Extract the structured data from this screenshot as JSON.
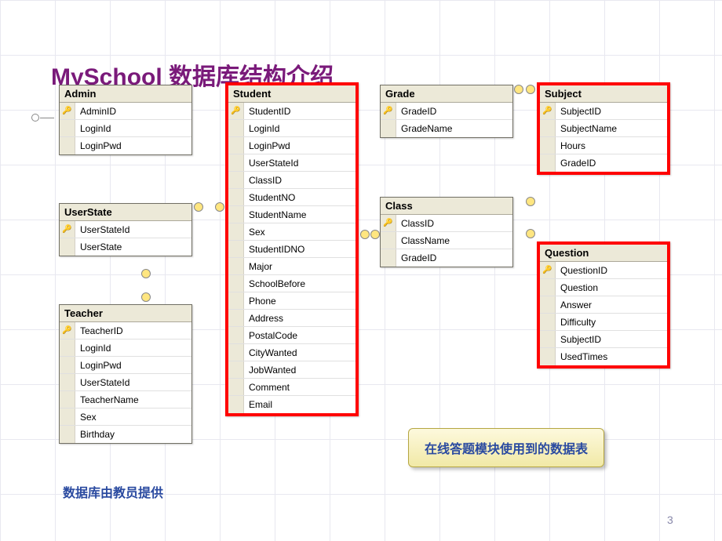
{
  "title": "MySchool 数据库结构介绍",
  "tables": {
    "admin": {
      "name": "Admin",
      "cols": [
        {
          "k": true,
          "n": "AdminID"
        },
        {
          "k": false,
          "n": "LoginId"
        },
        {
          "k": false,
          "n": "LoginPwd"
        }
      ]
    },
    "userstate": {
      "name": "UserState",
      "cols": [
        {
          "k": true,
          "n": "UserStateId"
        },
        {
          "k": false,
          "n": "UserState"
        }
      ]
    },
    "teacher": {
      "name": "Teacher",
      "cols": [
        {
          "k": true,
          "n": "TeacherID"
        },
        {
          "k": false,
          "n": "LoginId"
        },
        {
          "k": false,
          "n": "LoginPwd"
        },
        {
          "k": false,
          "n": "UserStateId"
        },
        {
          "k": false,
          "n": "TeacherName"
        },
        {
          "k": false,
          "n": "Sex"
        },
        {
          "k": false,
          "n": "Birthday"
        }
      ]
    },
    "student": {
      "name": "Student",
      "cols": [
        {
          "k": true,
          "n": "StudentID"
        },
        {
          "k": false,
          "n": "LoginId"
        },
        {
          "k": false,
          "n": "LoginPwd"
        },
        {
          "k": false,
          "n": "UserStateId"
        },
        {
          "k": false,
          "n": "ClassID"
        },
        {
          "k": false,
          "n": "StudentNO"
        },
        {
          "k": false,
          "n": "StudentName"
        },
        {
          "k": false,
          "n": "Sex"
        },
        {
          "k": false,
          "n": "StudentIDNO"
        },
        {
          "k": false,
          "n": "Major"
        },
        {
          "k": false,
          "n": "SchoolBefore"
        },
        {
          "k": false,
          "n": "Phone"
        },
        {
          "k": false,
          "n": "Address"
        },
        {
          "k": false,
          "n": "PostalCode"
        },
        {
          "k": false,
          "n": "CityWanted"
        },
        {
          "k": false,
          "n": "JobWanted"
        },
        {
          "k": false,
          "n": "Comment"
        },
        {
          "k": false,
          "n": "Email"
        }
      ]
    },
    "grade": {
      "name": "Grade",
      "cols": [
        {
          "k": true,
          "n": "GradeID"
        },
        {
          "k": false,
          "n": "GradeName"
        }
      ]
    },
    "class": {
      "name": "Class",
      "cols": [
        {
          "k": true,
          "n": "ClassID"
        },
        {
          "k": false,
          "n": "ClassName"
        },
        {
          "k": false,
          "n": "GradeID"
        }
      ]
    },
    "subject": {
      "name": "Subject",
      "cols": [
        {
          "k": true,
          "n": "SubjectID"
        },
        {
          "k": false,
          "n": "SubjectName"
        },
        {
          "k": false,
          "n": "Hours"
        },
        {
          "k": false,
          "n": "GradeID"
        }
      ]
    },
    "question": {
      "name": "Question",
      "cols": [
        {
          "k": true,
          "n": "QuestionID"
        },
        {
          "k": false,
          "n": "Question"
        },
        {
          "k": false,
          "n": "Answer"
        },
        {
          "k": false,
          "n": "Difficulty"
        },
        {
          "k": false,
          "n": "SubjectID"
        },
        {
          "k": false,
          "n": "UsedTimes"
        }
      ]
    }
  },
  "callout": "在线答题模块使用到的数据表",
  "footer": "数据库由教员提供",
  "page": "3",
  "keyGlyph": "🔑"
}
